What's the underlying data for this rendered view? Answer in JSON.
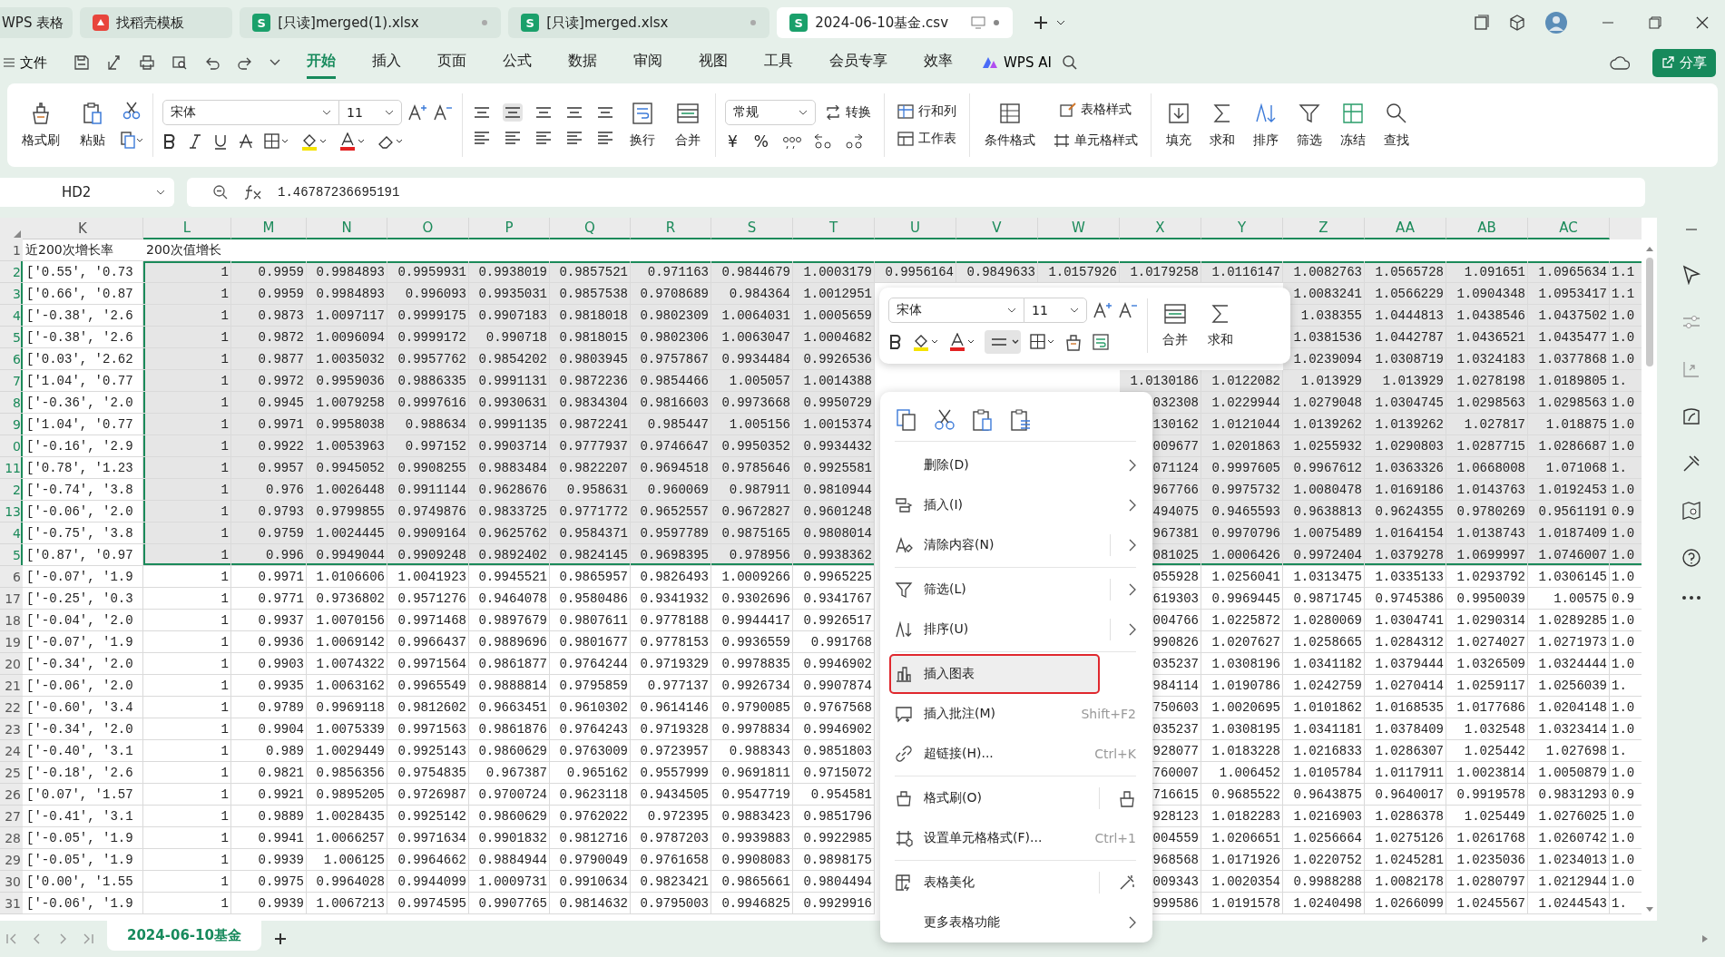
{
  "tabs": [
    {
      "label": "WPS 表格",
      "selected": false,
      "kind": "app"
    },
    {
      "label": "找稻壳模板",
      "selected": false,
      "kind": "docer"
    },
    {
      "label": "[只读]merged(1).xlsx",
      "selected": false,
      "kind": "sheet",
      "badge": "S"
    },
    {
      "label": "[只读]merged.xlsx",
      "selected": false,
      "kind": "sheet",
      "badge": "S"
    },
    {
      "label": "2024-06-10基金.csv",
      "selected": true,
      "kind": "sheet",
      "badge": "S"
    }
  ],
  "menu": {
    "file": "文件",
    "tabs": [
      {
        "label": "开始",
        "selected": true
      },
      {
        "label": "插入",
        "selected": false
      },
      {
        "label": "页面",
        "selected": false
      },
      {
        "label": "公式",
        "selected": false
      },
      {
        "label": "数据",
        "selected": false
      },
      {
        "label": "审阅",
        "selected": false
      },
      {
        "label": "视图",
        "selected": false
      },
      {
        "label": "工具",
        "selected": false
      },
      {
        "label": "会员专享",
        "selected": false
      },
      {
        "label": "效率",
        "selected": false
      }
    ],
    "ai": "WPS AI",
    "share": "分享"
  },
  "ribbon": {
    "format_painter": "格式刷",
    "paste": "粘贴",
    "font": "宋体",
    "size": "11",
    "wrap": "换行",
    "merge": "合并",
    "number_format": "常规",
    "convert": "转换",
    "currency": "¥",
    "percent": "%",
    "rows_cols": "行和列",
    "worksheet": "工作表",
    "conditional": "条件格式",
    "table_style": "表格样式",
    "cell_style": "单元格样式",
    "tools": [
      "填充",
      "求和",
      "排序",
      "筛选",
      "冻结",
      "查找"
    ]
  },
  "formula_bar": {
    "cell": "HD2",
    "value": "1.46787236695191"
  },
  "columns": [
    {
      "label": "K",
      "selected": false
    },
    {
      "label": "L",
      "selected": true
    },
    {
      "label": "M",
      "selected": true
    },
    {
      "label": "N",
      "selected": true
    },
    {
      "label": "O",
      "selected": true
    },
    {
      "label": "P",
      "selected": true
    },
    {
      "label": "Q",
      "selected": true
    },
    {
      "label": "R",
      "selected": true
    },
    {
      "label": "S",
      "selected": true
    },
    {
      "label": "T",
      "selected": true
    },
    {
      "label": "U",
      "selected": true
    },
    {
      "label": "V",
      "selected": true
    },
    {
      "label": "W",
      "selected": true
    },
    {
      "label": "X",
      "selected": true
    },
    {
      "label": "Y",
      "selected": true
    },
    {
      "label": "Z",
      "selected": true
    },
    {
      "label": "AA",
      "selected": true
    },
    {
      "label": "AB",
      "selected": true
    },
    {
      "label": "AC",
      "selected": true
    }
  ],
  "rows": [
    {
      "n": "1",
      "selected": false,
      "cells": [
        "近200次增长率",
        "200次值增长",
        null,
        null,
        null,
        null,
        null,
        null,
        null,
        null,
        null,
        null,
        null,
        null,
        null,
        null,
        null,
        null,
        null,
        null
      ]
    },
    {
      "n": "2",
      "selected": true,
      "cells": [
        "['0.55', '0.73",
        "1",
        "0.9959",
        "0.9984893",
        "0.9959931",
        "0.9938019",
        "0.9857521",
        "0.971163",
        "0.9844679",
        "1.0003179",
        "0.9956164",
        "0.9849633",
        "1.0157926",
        "1.0179258",
        "1.0116147",
        "1.0082763",
        "1.0565728",
        "1.091651",
        "1.0965634",
        "1.1"
      ]
    },
    {
      "n": "3",
      "selected": true,
      "cells": [
        "['0.66', '0.87",
        "1",
        "0.9959",
        "0.9984893",
        "0.996093",
        "0.9935031",
        "0.9857538",
        "0.9708689",
        "0.984364",
        "1.0012951",
        null,
        null,
        null,
        null,
        null,
        "1.0083241",
        "1.0566229",
        "1.0904348",
        "1.0953417",
        "1.1"
      ]
    },
    {
      "n": "4",
      "selected": true,
      "cells": [
        "['-0.38', '2.6",
        "1",
        "0.9873",
        "1.0097117",
        "0.9999175",
        "0.9907183",
        "0.9818018",
        "0.9802309",
        "1.0064031",
        "1.0005659",
        null,
        null,
        null,
        null,
        null,
        "1.038355",
        "1.0444813",
        "1.0438546",
        "1.0437502",
        "1.0"
      ]
    },
    {
      "n": "5",
      "selected": true,
      "cells": [
        "['-0.38', '2.6",
        "1",
        "0.9872",
        "1.0096094",
        "0.9999172",
        "0.990718",
        "0.9818015",
        "0.9802306",
        "1.0063047",
        "1.0004682",
        null,
        null,
        null,
        null,
        null,
        "1.0381536",
        "1.0442787",
        "1.0436521",
        "1.0435477",
        "1.0"
      ]
    },
    {
      "n": "6",
      "selected": true,
      "cells": [
        "['0.03', '2.62",
        "1",
        "0.9877",
        "1.0035032",
        "0.9957762",
        "0.9854202",
        "0.9803945",
        "0.9757867",
        "0.9934484",
        "0.9926536",
        null,
        null,
        null,
        null,
        null,
        "1.0239094",
        "1.0308719",
        "1.0324183",
        "1.0377868",
        "1.0"
      ]
    },
    {
      "n": "7",
      "selected": true,
      "cells": [
        "['1.04', '0.77",
        "1",
        "0.9972",
        "0.9959036",
        "0.9886335",
        "0.9991131",
        "0.9872236",
        "0.9854466",
        "1.005057",
        "1.0014388",
        null,
        null,
        null,
        "1.0130186",
        "1.0122082",
        "1.013929",
        "1.013929",
        "1.0278198",
        "1.0189805",
        "1."
      ]
    },
    {
      "n": "8",
      "selected": true,
      "cells": [
        "['-0.36', '2.0",
        "1",
        "0.9945",
        "1.0079258",
        "0.9997616",
        "0.9930631",
        "0.9834304",
        "0.9816603",
        "0.9973668",
        "0.9950729",
        null,
        null,
        null,
        "032308",
        "1.0229944",
        "1.0279048",
        "1.0304745",
        "1.0298563",
        "1.0298563",
        "1.0"
      ]
    },
    {
      "n": "9",
      "selected": true,
      "cells": [
        "['1.04', '0.77",
        "1",
        "0.9971",
        "0.9958038",
        "0.988634",
        "0.9991135",
        "0.9872241",
        "0.985447",
        "1.005156",
        "1.0015374",
        null,
        null,
        null,
        "130162",
        "1.0121044",
        "1.0139262",
        "1.0139262",
        "1.027817",
        "1.018875",
        "1.0"
      ]
    },
    {
      "n": "0",
      "selected": true,
      "cells": [
        "['-0.16', '2.9",
        "1",
        "0.9922",
        "1.0053963",
        "0.997152",
        "0.9903714",
        "0.9777937",
        "0.9746647",
        "0.9950352",
        "0.9934432",
        null,
        null,
        null,
        "009677",
        "1.0201863",
        "1.0255932",
        "1.0290803",
        "1.0287715",
        "1.0286687",
        "1.0"
      ]
    },
    {
      "n": "11",
      "selected": true,
      "cells": [
        "['0.78', '1.23",
        "1",
        "0.9957",
        "0.9945052",
        "0.9908255",
        "0.9883484",
        "0.9822207",
        "0.9694518",
        "0.9785646",
        "0.9925581",
        null,
        null,
        null,
        "071124",
        "0.9997605",
        "0.9967612",
        "1.0363326",
        "1.0668008",
        "1.071068",
        "1."
      ]
    },
    {
      "n": "2",
      "selected": true,
      "cells": [
        "['-0.74', '3.8",
        "1",
        "0.976",
        "1.0026448",
        "0.9911144",
        "0.9628676",
        "0.958631",
        "0.960069",
        "0.987911",
        "0.9810944",
        null,
        null,
        null,
        "967766",
        "0.9975732",
        "1.0080478",
        "1.0169186",
        "1.0143763",
        "1.0192453",
        "1.0"
      ]
    },
    {
      "n": "13",
      "selected": true,
      "cells": [
        "['-0.06', '2.0",
        "1",
        "0.9793",
        "0.9799855",
        "0.9749876",
        "0.9833725",
        "0.9771772",
        "0.9652557",
        "0.9672827",
        "0.9601248",
        null,
        null,
        null,
        "494075",
        "0.9465593",
        "0.9638813",
        "0.9624355",
        "0.9780269",
        "0.9561191",
        "0.9"
      ]
    },
    {
      "n": "4",
      "selected": true,
      "cells": [
        "['-0.75', '3.8",
        "1",
        "0.9759",
        "1.0024445",
        "0.9909164",
        "0.9625762",
        "0.9584371",
        "0.9597789",
        "0.9875165",
        "0.9808014",
        null,
        null,
        null,
        "967381",
        "0.9970796",
        "1.0075489",
        "1.0164154",
        "1.0138743",
        "1.0187409",
        "1.0"
      ]
    },
    {
      "n": "5",
      "selected": true,
      "cells": [
        "['0.87', '0.97",
        "1",
        "0.996",
        "0.9949044",
        "0.9909248",
        "0.9892402",
        "0.9824145",
        "0.9698395",
        "0.978956",
        "0.9938362",
        null,
        null,
        null,
        "081025",
        "1.0006426",
        "0.9972404",
        "1.0379278",
        "1.0699997",
        "1.0746007",
        "1.0"
      ]
    },
    {
      "n": "6",
      "selected": false,
      "cells": [
        "['-0.07', '1.9",
        "1",
        "0.9971",
        "1.0106606",
        "1.0041923",
        "0.9945521",
        "0.9865957",
        "0.9826493",
        "1.0009266",
        "0.9965225",
        null,
        null,
        null,
        "055928",
        "1.0256041",
        "1.0313475",
        "1.0335133",
        "1.0293792",
        "1.0306145",
        "1.0"
      ]
    },
    {
      "n": "17",
      "selected": false,
      "cells": [
        "['-0.25', '0.3",
        "1",
        "0.9771",
        "0.9736802",
        "0.9571276",
        "0.9464078",
        "0.9580486",
        "0.9341932",
        "0.9302696",
        "0.9341767",
        null,
        null,
        null,
        "619303",
        "0.9969445",
        "0.9871745",
        "0.9745386",
        "0.9950039",
        "1.00575",
        "0.9"
      ]
    },
    {
      "n": "18",
      "selected": false,
      "cells": [
        "['-0.04', '2.0",
        "1",
        "0.9937",
        "1.0070156",
        "0.9971468",
        "0.9897679",
        "0.9807611",
        "0.9778188",
        "0.9944417",
        "0.9926517",
        null,
        null,
        null,
        "004766",
        "1.0225872",
        "1.0280069",
        "1.0304741",
        "1.0290314",
        "1.0289285",
        "1.0"
      ]
    },
    {
      "n": "19",
      "selected": false,
      "cells": [
        "['-0.07', '1.9",
        "1",
        "0.9936",
        "1.0069142",
        "0.9966437",
        "0.9889696",
        "0.9801677",
        "0.9778153",
        "0.9936559",
        "0.991768",
        null,
        null,
        null,
        "990826",
        "1.0207627",
        "1.0258665",
        "1.0284312",
        "1.0274027",
        "1.0271973",
        "1.0"
      ]
    },
    {
      "n": "20",
      "selected": false,
      "cells": [
        "['-0.34', '2.0",
        "1",
        "0.9903",
        "1.0074322",
        "0.9971564",
        "0.9861877",
        "0.9764244",
        "0.9719329",
        "0.9978835",
        "0.9946902",
        null,
        null,
        null,
        "035237",
        "1.0308196",
        "1.0341182",
        "1.0379444",
        "1.0326509",
        "1.0324444",
        "1.0"
      ]
    },
    {
      "n": "21",
      "selected": false,
      "cells": [
        "['-0.06', '2.0",
        "1",
        "0.9935",
        "1.0063162",
        "0.9965549",
        "0.9888814",
        "0.9795859",
        "0.977137",
        "0.9926734",
        "0.9907874",
        null,
        null,
        null,
        "984114",
        "1.0190786",
        "1.0242759",
        "1.0270414",
        "1.0259117",
        "1.0256039",
        "1."
      ]
    },
    {
      "n": "22",
      "selected": false,
      "cells": [
        "['-0.60', '3.4",
        "1",
        "0.9789",
        "0.9969118",
        "0.9812602",
        "0.9663451",
        "0.9610302",
        "0.9614146",
        "0.9790085",
        "0.9767568",
        null,
        null,
        null,
        "750603",
        "1.0020695",
        "1.0101862",
        "1.0168535",
        "1.0177686",
        "1.0204148",
        "1.0"
      ]
    },
    {
      "n": "23",
      "selected": false,
      "cells": [
        "['-0.34', '2.0",
        "1",
        "0.9904",
        "1.0075339",
        "0.9971563",
        "0.9861876",
        "0.9764243",
        "0.9719328",
        "0.9978834",
        "0.9946902",
        null,
        null,
        null,
        "035237",
        "1.0308195",
        "1.0341181",
        "1.0378409",
        "1.032548",
        "1.0323414",
        "1.0"
      ]
    },
    {
      "n": "24",
      "selected": false,
      "cells": [
        "['-0.40', '3.1",
        "1",
        "0.989",
        "1.0029449",
        "0.9925143",
        "0.9860629",
        "0.9763009",
        "0.9723957",
        "0.988343",
        "0.9851803",
        null,
        null,
        null,
        "928077",
        "1.0183228",
        "1.0216833",
        "1.0286307",
        "1.025442",
        "1.027698",
        "1."
      ]
    },
    {
      "n": "25",
      "selected": false,
      "cells": [
        "['-0.18', '2.6",
        "1",
        "0.9821",
        "0.9856356",
        "0.9754835",
        "0.967387",
        "0.965162",
        "0.9557999",
        "0.9691811",
        "0.9715072",
        null,
        null,
        null,
        "760007",
        "1.006452",
        "1.0105784",
        "1.0117911",
        "1.0023814",
        "1.0050879",
        "1.0"
      ]
    },
    {
      "n": "26",
      "selected": false,
      "cells": [
        "['0.07', '1.57",
        "1",
        "0.9921",
        "0.9895205",
        "0.9726987",
        "0.9700724",
        "0.9623118",
        "0.9434505",
        "0.9547719",
        "0.954581",
        null,
        null,
        null,
        "716615",
        "0.9685522",
        "0.9643875",
        "0.9640017",
        "0.9919578",
        "0.9831293",
        "0.9"
      ]
    },
    {
      "n": "27",
      "selected": false,
      "cells": [
        "['-0.41', '3.1",
        "1",
        "0.9889",
        "1.0028435",
        "0.9925142",
        "0.9860629",
        "0.9762022",
        "0.972395",
        "0.9883423",
        "0.9851796",
        null,
        null,
        null,
        "928123",
        "1.0182283",
        "1.0216903",
        "1.0286378",
        "1.025449",
        "1.0276025",
        "1.0"
      ]
    },
    {
      "n": "28",
      "selected": false,
      "cells": [
        "['-0.05', '1.9",
        "1",
        "0.9941",
        "1.0066257",
        "0.9971634",
        "0.9901832",
        "0.9812716",
        "0.9787203",
        "0.9939883",
        "0.9922985",
        null,
        null,
        null,
        "004559",
        "1.0206651",
        "1.0256664",
        "1.0275126",
        "1.0261768",
        "1.0260742",
        "1.0"
      ]
    },
    {
      "n": "29",
      "selected": false,
      "cells": [
        "['-0.05', '1.9",
        "1",
        "0.9939",
        "1.006125",
        "0.9964662",
        "0.9884944",
        "0.9790049",
        "0.9761658",
        "0.9908083",
        "0.9898175",
        null,
        null,
        null,
        "968568",
        "1.0171926",
        "1.0220752",
        "1.0245281",
        "1.0235036",
        "1.0234013",
        "1.0"
      ]
    },
    {
      "n": "30",
      "selected": false,
      "cells": [
        "['0.00', '1.55",
        "1",
        "0.9975",
        "0.9964028",
        "0.9944099",
        "1.0009731",
        "0.9910634",
        "0.9823421",
        "0.9865661",
        "0.9804494",
        null,
        null,
        null,
        "009343",
        "1.0020354",
        "0.9988288",
        "1.0082178",
        "1.0280797",
        "1.0212944",
        "1.0"
      ]
    },
    {
      "n": "31",
      "selected": false,
      "cells": [
        "['-0.06', '1.9",
        "1",
        "0.9939",
        "1.0067213",
        "0.9974595",
        "0.9907765",
        "0.9814632",
        "0.9795003",
        "0.9946825",
        "0.9929916",
        null,
        null,
        null,
        "999586",
        "1.0191578",
        "1.0240498",
        "1.0266099",
        "1.0245567",
        "1.0244543",
        "1."
      ]
    }
  ],
  "mini_toolbar": {
    "font": "宋体",
    "size": "11",
    "merge": "合并",
    "sum": "求和"
  },
  "context_menu": [
    {
      "label": "删除(D)",
      "submenu": true,
      "selected": false
    },
    {
      "label": "插入(I)",
      "submenu": true,
      "selected": false
    },
    {
      "label": "清除内容(N)",
      "submenu": true,
      "selected": false
    },
    {
      "label": "筛选(L)",
      "submenu": true,
      "selected": false
    },
    {
      "label": "排序(U)",
      "submenu": true,
      "selected": false
    },
    {
      "label": "插入图表",
      "submenu": false,
      "selected": true
    },
    {
      "label": "插入批注(M)",
      "shortcut": "Shift+F2",
      "submenu": false,
      "selected": false
    },
    {
      "label": "超链接(H)...",
      "shortcut": "Ctrl+K",
      "submenu": false,
      "selected": false
    },
    {
      "label": "格式刷(O)",
      "side_button": true,
      "submenu": false,
      "selected": false
    },
    {
      "label": "设置单元格格式(F)...",
      "shortcut": "Ctrl+1",
      "submenu": false,
      "selected": false
    },
    {
      "label": "表格美化",
      "side_button": true,
      "submenu": false,
      "selected": false
    },
    {
      "label": "更多表格功能",
      "submenu": true,
      "selected": false
    }
  ],
  "sheet_tabs": [
    {
      "label": "2024-06-10基金",
      "selected": true
    }
  ]
}
